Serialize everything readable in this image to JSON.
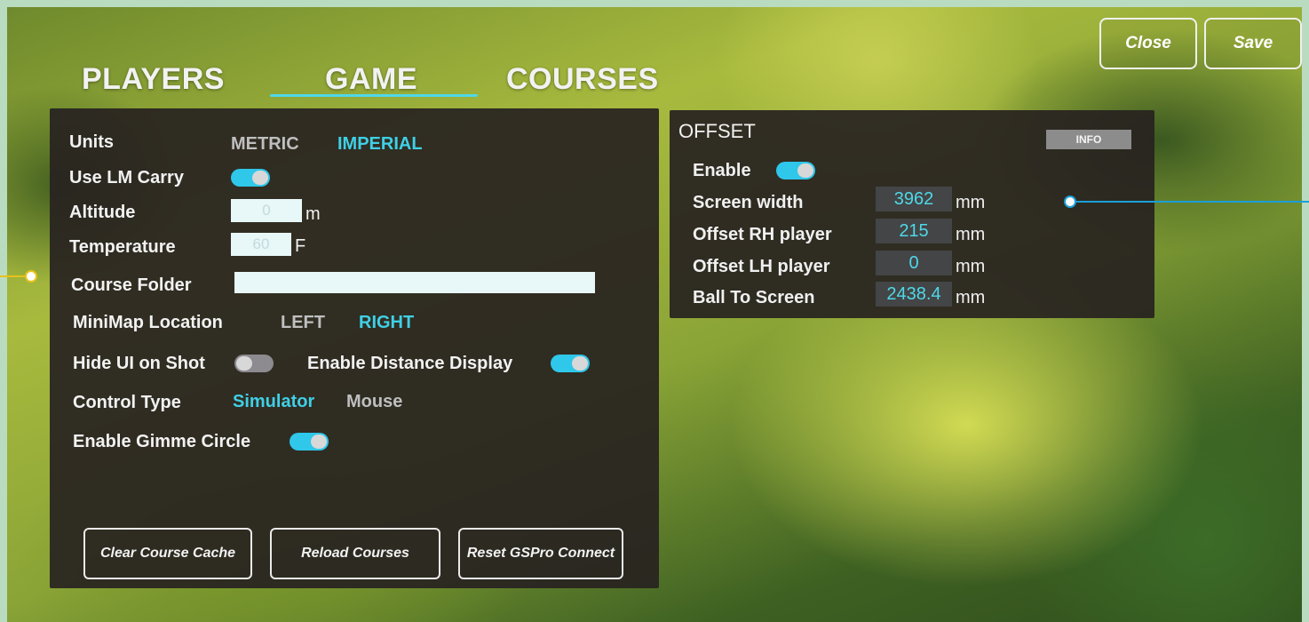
{
  "header": {
    "tabs": [
      {
        "label": "PLAYERS",
        "active": false
      },
      {
        "label": "GAME",
        "active": true
      },
      {
        "label": "COURSES",
        "active": false
      }
    ],
    "close_label": "Close",
    "save_label": "Save"
  },
  "game": {
    "units": {
      "label": "Units",
      "options": [
        "METRIC",
        "IMPERIAL"
      ],
      "selected": "IMPERIAL"
    },
    "use_lm_carry": {
      "label": "Use LM Carry",
      "on": true
    },
    "altitude": {
      "label": "Altitude",
      "value": "0",
      "unit": "m"
    },
    "temperature": {
      "label": "Temperature",
      "value": "60",
      "unit": "F"
    },
    "course_folder": {
      "label": "Course Folder",
      "value": ""
    },
    "minimap": {
      "label": "MiniMap Location",
      "options": [
        "LEFT",
        "RIGHT"
      ],
      "selected": "RIGHT"
    },
    "hide_ui": {
      "label": "Hide UI on Shot",
      "on": false
    },
    "distance_display": {
      "label": "Enable Distance Display",
      "on": true
    },
    "control_type": {
      "label": "Control Type",
      "options": [
        "Simulator",
        "Mouse"
      ],
      "selected": "Simulator"
    },
    "gimme_circle": {
      "label": "Enable Gimme Circle",
      "on": true
    },
    "buttons": {
      "clear_cache": "Clear Course Cache",
      "reload": "Reload Courses",
      "reset_connect": "Reset GSPro Connect"
    }
  },
  "offset": {
    "title": "OFFSET",
    "info_label": "INFO",
    "enable": {
      "label": "Enable",
      "on": true
    },
    "rows": [
      {
        "label": "Screen width",
        "value": "3962",
        "unit": "mm"
      },
      {
        "label": "Offset RH player",
        "value": "215",
        "unit": "mm"
      },
      {
        "label": "Offset LH player",
        "value": "0",
        "unit": "mm"
      },
      {
        "label": "Ball To Screen",
        "value": "2438.4",
        "unit": "mm"
      }
    ]
  },
  "colors": {
    "accent": "#3fd0e6",
    "panel": "#28221f",
    "marker_left": "#e8c21a",
    "marker_right": "#1a9fd8"
  }
}
